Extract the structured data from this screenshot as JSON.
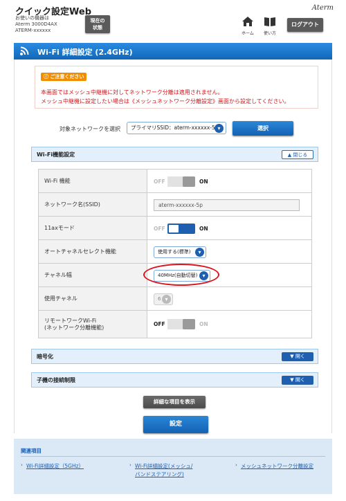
{
  "header": {
    "app_title": "クイック設定Web",
    "device_line1": "お使いの機器は",
    "device_line2": "Aterm 3000D4AX",
    "device_line3": "ATERM-xxxxxx",
    "status_line1": "現在の",
    "status_line2": "状態",
    "brand": "Aterm",
    "home_label": "ホーム",
    "help_label": "使い方",
    "logout_label": "ログアウト"
  },
  "page": {
    "title": "Wi-Fi 詳細設定 (2.4GHz)"
  },
  "caution": {
    "badge": "ご注意ください",
    "line1": "本画面ではメッシュ中継機に対してネットワーク分離は適用されません。",
    "line2": "メッシュ中継機に設定したい場合は《メッシュネットワーク分離設定》画面から設定してください。"
  },
  "network_select": {
    "label": "対象ネットワークを選択",
    "value": "プライマリSSID：aterm-xxxxxx-5p",
    "button": "選択"
  },
  "wifi_function_section": {
    "title": "Wi-Fi機能設定",
    "toggle": "閉じる",
    "rows": [
      {
        "key": "Wi-Fi 機能",
        "off": "OFF",
        "on": "ON",
        "state": "on"
      },
      {
        "key": "ネットワーク名(SSID)",
        "value": "aterm-xxxxxx-5p"
      },
      {
        "key": "11axモード",
        "off": "OFF",
        "on": "ON",
        "state": "on"
      },
      {
        "key": "オートチャネルセレクト機能",
        "value": "使用する(標準)"
      },
      {
        "key": "チャネル幅",
        "value": "40MHz(自動切替)"
      },
      {
        "key": "使用チャネル",
        "value": "6"
      },
      {
        "key_line1": "リモートワークWi-Fi",
        "key_line2": "(ネットワーク分離機能)",
        "off": "OFF",
        "on": "ON",
        "state": "off"
      }
    ]
  },
  "encryption_section": {
    "title": "暗号化",
    "toggle": "開く"
  },
  "client_limit_section": {
    "title": "子機の接続制限",
    "toggle": "開く"
  },
  "buttons": {
    "show_detail": "詳細な項目を表示",
    "set": "設定"
  },
  "related": {
    "title": "関連項目",
    "links": [
      {
        "line1": "Wi-Fi詳細設定（5GHz）"
      },
      {
        "line1": "Wi-Fi詳細設定(メッシュ/",
        "line2": "バンドステアリング)"
      },
      {
        "line1": "メッシュネットワーク分離設定"
      }
    ]
  },
  "colors": {
    "primary_blue": "#1f5fb0",
    "caution_red": "#c8191e",
    "highlight_red": "#e0101a"
  }
}
